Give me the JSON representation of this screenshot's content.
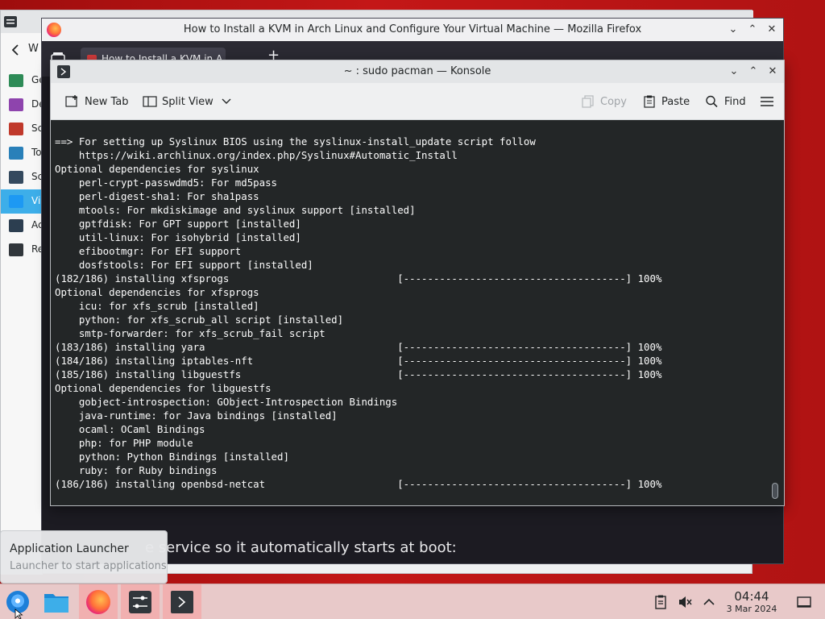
{
  "firefox": {
    "window_title": "How to Install a KVM in Arch Linux and Configure Your Virtual Machine — Mozilla Firefox",
    "tab_label": "How to Install a KVM in A",
    "article_text": "e service so it automatically starts at boot:"
  },
  "settings": {
    "sidebar_items": [
      {
        "label": "Ge",
        "icon": "appearance-icon",
        "color": "#2e8b57"
      },
      {
        "label": "De",
        "icon": "workspace-icon",
        "color": "#8e44ad"
      },
      {
        "label": "Sc",
        "icon": "shortcuts-icon",
        "color": "#c0392b"
      },
      {
        "label": "To",
        "icon": "input-icon",
        "color": "#2980b9"
      },
      {
        "label": "Sc",
        "icon": "security-icon",
        "color": "#34495e"
      },
      {
        "label": "Vi",
        "icon": "display-icon",
        "color": "#1d99f3"
      },
      {
        "label": "Ac",
        "icon": "accessibility-icon",
        "color": "#2c3e50"
      },
      {
        "label": "Re",
        "icon": "clock-icon",
        "color": "#31363b"
      }
    ],
    "back_label": "W"
  },
  "konsole": {
    "window_title": "~ : sudo pacman — Konsole",
    "toolbar": {
      "new_tab": "New Tab",
      "split_view": "Split View",
      "copy": "Copy",
      "paste": "Paste",
      "find": "Find"
    },
    "terminal_lines": [
      "==> For setting up Syslinux BIOS using the syslinux-install_update script follow",
      "    https://wiki.archlinux.org/index.php/Syslinux#Automatic_Install",
      "Optional dependencies for syslinux",
      "    perl-crypt-passwdmd5: For md5pass",
      "    perl-digest-sha1: For sha1pass",
      "    mtools: For mkdiskimage and syslinux support [installed]",
      "    gptfdisk: For GPT support [installed]",
      "    util-linux: For isohybrid [installed]",
      "    efibootmgr: For EFI support",
      "    dosfstools: For EFI support [installed]",
      "(182/186) installing xfsprogs                            [-------------------------------------] 100%",
      "Optional dependencies for xfsprogs",
      "    icu: for xfs_scrub [installed]",
      "    python: for xfs_scrub_all script [installed]",
      "    smtp-forwarder: for xfs_scrub_fail script",
      "(183/186) installing yara                                [-------------------------------------] 100%",
      "(184/186) installing iptables-nft                        [-------------------------------------] 100%",
      "(185/186) installing libguestfs                          [-------------------------------------] 100%",
      "Optional dependencies for libguestfs",
      "    gobject-introspection: GObject-Introspection Bindings",
      "    java-runtime: for Java bindings [installed]",
      "    ocaml: OCaml Bindings",
      "    php: for PHP module",
      "    python: Python Bindings [installed]",
      "    ruby: for Ruby bindings",
      "(186/186) installing openbsd-netcat                      [-------------------------------------] 100%"
    ]
  },
  "tooltip": {
    "title": "Application Launcher",
    "subtitle": "Launcher to start applications"
  },
  "taskbar": {
    "time": "04:44",
    "date": "3 Mar 2024"
  }
}
